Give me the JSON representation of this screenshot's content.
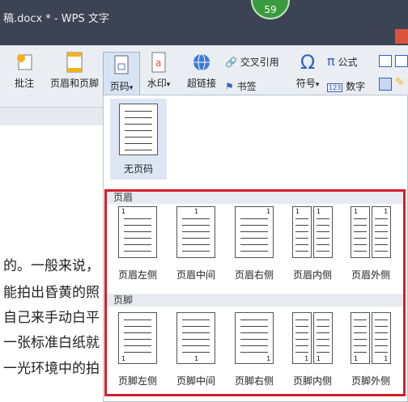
{
  "window": {
    "title": "稿.docx * - WPS 文字",
    "badge": "59"
  },
  "ribbon": {
    "comment": "批注",
    "header_footer": "页眉和页脚",
    "page_number": "页码",
    "watermark": "水印",
    "hyperlink": "超链接",
    "cross_ref": "交叉引用",
    "bookmark": "书签",
    "symbol": "符号",
    "formula": "公式",
    "number": "数字",
    "dropdown_glyph": "▾",
    "cross_ref_glyph": "🔗",
    "bookmark_glyph": "⚑",
    "symbol_glyph": "Ω",
    "formula_glyph": "π",
    "number_glyph": "123",
    "extra_glyph": "✎"
  },
  "document": {
    "lines": [
      "的。一般来说，",
      "能拍出昏黄的照",
      "自己来手动白平",
      "一张标准白纸就",
      "一光环境中的拍"
    ]
  },
  "popup": {
    "no_page_label": "无页码",
    "header_section": "页眉",
    "footer_section": "页脚",
    "header_items": [
      "页眉左侧",
      "页眉中间",
      "页眉右侧",
      "页眉内侧",
      "页眉外侧"
    ],
    "footer_items": [
      "页脚左侧",
      "页脚中间",
      "页脚右侧",
      "页脚内侧",
      "页脚外侧"
    ],
    "page_num_glyph": "1"
  },
  "colors": {
    "highlight": "#d11f2c",
    "titlebar": "#3c4354",
    "ribbon": "#eaeef3"
  }
}
